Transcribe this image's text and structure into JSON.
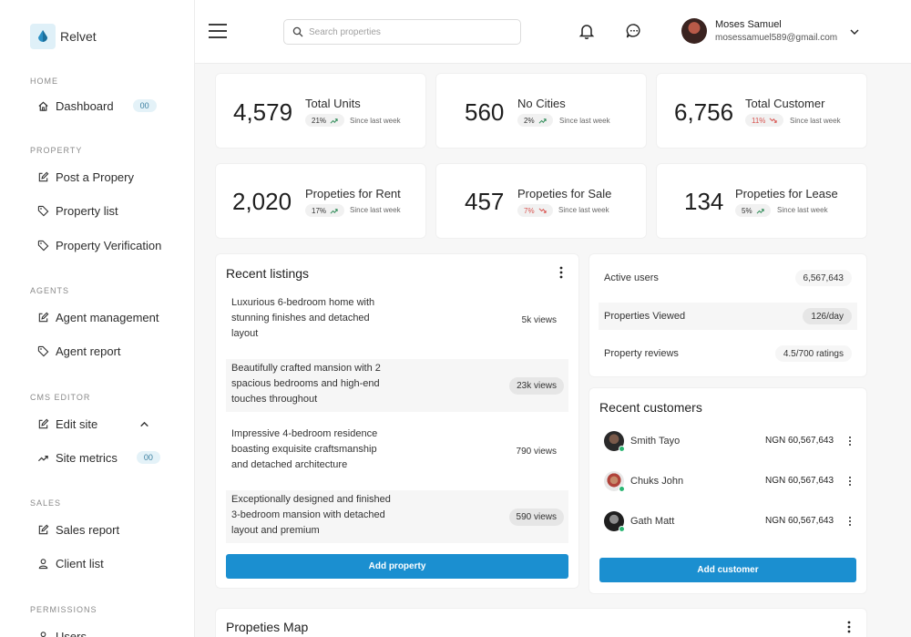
{
  "brand": {
    "name": "Relvet"
  },
  "sidebar": {
    "sections": {
      "home": "HOME",
      "property": "PROPERTY",
      "agents": "AGENTS",
      "cms": "CMS EDITOR",
      "sales": "SALES",
      "permissions": "PERMISSIONS"
    },
    "items": {
      "dashboard": {
        "label": "Dashboard",
        "badge": "00"
      },
      "post_property": {
        "label": "Post a Propery"
      },
      "property_list": {
        "label": "Property list"
      },
      "property_verification": {
        "label": "Property Verification"
      },
      "agent_management": {
        "label": "Agent management"
      },
      "agent_report": {
        "label": "Agent report"
      },
      "edit_site": {
        "label": "Edit site"
      },
      "site_metrics": {
        "label": "Site metrics",
        "badge": "00"
      },
      "sales_report": {
        "label": "Sales report"
      },
      "client_list": {
        "label": "Client list"
      },
      "users": {
        "label": "Users"
      }
    }
  },
  "header": {
    "search_placeholder": "Search properties",
    "user": {
      "name": "Moses Samuel",
      "email": "mosessamuel589@gmail.com"
    }
  },
  "stats": [
    {
      "value": "4,579",
      "label": "Total Units",
      "change": "21%",
      "trend": "up",
      "since": "Since last week"
    },
    {
      "value": "560",
      "label": "No Cities",
      "change": "2%",
      "trend": "up",
      "since": "Since last week"
    },
    {
      "value": "6,756",
      "label": "Total Customer",
      "change": "11%",
      "trend": "down",
      "since": "Since last week"
    },
    {
      "value": "2,020",
      "label": "Propeties for Rent",
      "change": "17%",
      "trend": "up",
      "since": "Since last week"
    },
    {
      "value": "457",
      "label": "Propeties for Sale",
      "change": "7%",
      "trend": "down",
      "since": "Since last week"
    },
    {
      "value": "134",
      "label": "Propeties for Lease",
      "change": "5%",
      "trend": "up",
      "since": "Since last week"
    }
  ],
  "listings": {
    "title": "Recent listings",
    "items": [
      {
        "text": "Luxurious 6-bedroom home with stunning finishes and detached layout",
        "views": "5k views"
      },
      {
        "text": "Beautifully crafted mansion with 2 spacious bedrooms and high-end touches throughout",
        "views": "23k views"
      },
      {
        "text": "Impressive 4-bedroom residence boasting exquisite craftsmanship and detached architecture",
        "views": "790 views"
      },
      {
        "text": "Exceptionally designed and finished 3-bedroom mansion with detached layout and premium",
        "views": "590 views"
      }
    ],
    "button": "Add property"
  },
  "metrics": [
    {
      "label": "Active users",
      "value": "6,567,643"
    },
    {
      "label": "Properties Viewed",
      "value": "126/day"
    },
    {
      "label": "Property reviews",
      "value": "4.5/700 ratings"
    }
  ],
  "customers": {
    "title": "Recent customers",
    "items": [
      {
        "name": "Smith Tayo",
        "amount": "NGN 60,567,643"
      },
      {
        "name": "Chuks John",
        "amount": "NGN 60,567,643"
      },
      {
        "name": "Gath Matt",
        "amount": "NGN 60,567,643"
      }
    ],
    "button": "Add customer"
  },
  "map": {
    "title": "Propeties Map"
  },
  "colors": {
    "primary": "#1b8fd0",
    "up": "#2e8b57",
    "down": "#d9534f",
    "online": "#2bb673"
  }
}
